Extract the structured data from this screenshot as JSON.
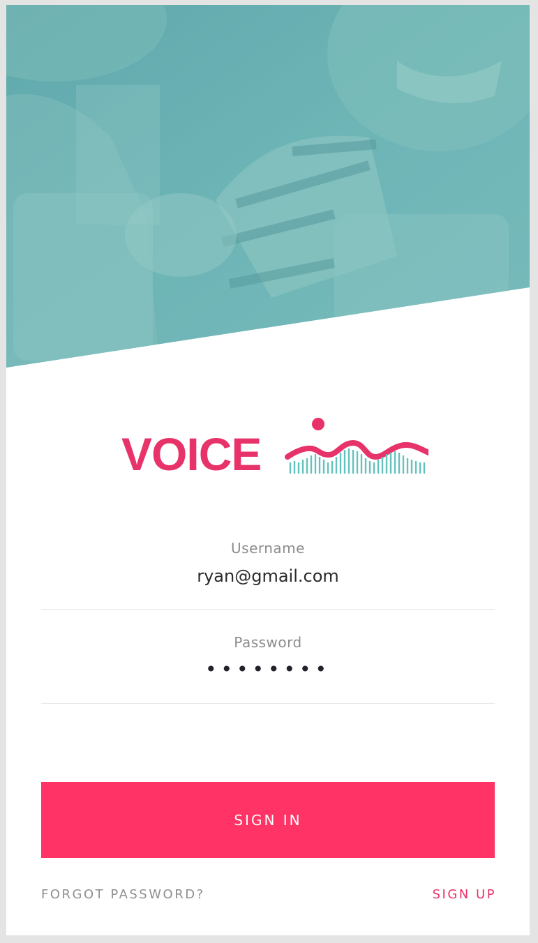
{
  "hero": {
    "image": "photo-two-people-with-mugs",
    "overlay_color": "#6fb6b8"
  },
  "logo": {
    "word": "VOICE",
    "mark": "voice-wave-icon",
    "brand_color": "#e8336a",
    "wave_color": "#64c2bd"
  },
  "form": {
    "username_label": "Username",
    "username_value": "ryan@gmail.com",
    "password_label": "Password",
    "password_value": "••••••••"
  },
  "actions": {
    "sign_in_label": "SIGN IN",
    "forgot_password_label": "FORGOT PASSWORD?",
    "sign_up_label": "SIGN UP",
    "accent_color": "#ff3366",
    "sign_up_color": "#e8336a"
  }
}
